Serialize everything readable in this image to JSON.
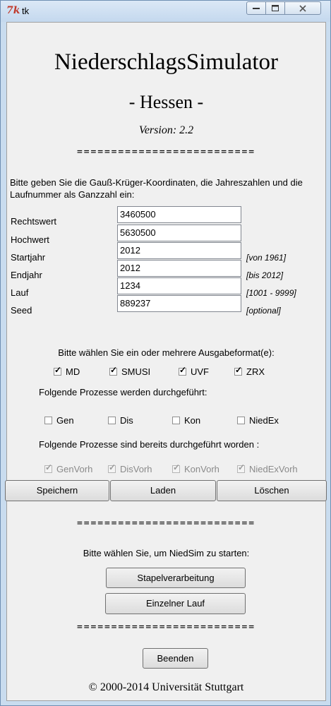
{
  "window": {
    "title": "tk",
    "icon_glyph": "7k"
  },
  "header": {
    "app_name": "NiederschlagsSimulator",
    "region": "- Hessen -",
    "version": "Version: 2.2"
  },
  "separator": "==========================",
  "instructions": "Bitte geben Sie die Gauß-Krüger-Koordinaten, die Jahreszahlen und die Laufnummer als Ganzzahl ein:",
  "fields": [
    {
      "label": "Rechtswert",
      "value": "3460500",
      "hint": ""
    },
    {
      "label": "Hochwert",
      "value": "5630500",
      "hint": ""
    },
    {
      "label": "Startjahr",
      "value": "2012",
      "hint": "[von 1961]"
    },
    {
      "label": "Endjahr",
      "value": "2012",
      "hint": "[bis 2012]"
    },
    {
      "label": "Lauf",
      "value": "1234",
      "hint": "[1001 - 9999]"
    },
    {
      "label": "Seed",
      "value": "889237",
      "hint": "[optional]"
    }
  ],
  "output_formats": {
    "heading": "Bitte wählen Sie ein oder mehrere Ausgabeformat(e):",
    "options": [
      {
        "label": "MD",
        "checked": true
      },
      {
        "label": "SMUSI",
        "checked": true
      },
      {
        "label": "UVF",
        "checked": true
      },
      {
        "label": "ZRX",
        "checked": true
      }
    ]
  },
  "processes": {
    "heading": "Folgende Prozesse werden durchgeführt:",
    "options": [
      {
        "label": "Gen",
        "checked": false
      },
      {
        "label": "Dis",
        "checked": false
      },
      {
        "label": "Kon",
        "checked": false
      },
      {
        "label": "NiedEx",
        "checked": false
      }
    ]
  },
  "done_processes": {
    "heading": "Folgende Prozesse sind bereits durchgeführt worden :",
    "options": [
      {
        "label": "GenVorh",
        "checked": true
      },
      {
        "label": "DisVorh",
        "checked": true
      },
      {
        "label": "KonVorh",
        "checked": true
      },
      {
        "label": "NiedExVorh",
        "checked": true
      }
    ]
  },
  "actions": {
    "save": "Speichern",
    "load": "Laden",
    "delete": "Löschen"
  },
  "start": {
    "prompt": "Bitte wählen Sie, um NiedSim zu starten:",
    "batch": "Stapelverarbeitung",
    "single": "Einzelner Lauf"
  },
  "quit": "Beenden",
  "footer": "© 2000-2014 Universität Stuttgart",
  "check_glyph": "✓"
}
